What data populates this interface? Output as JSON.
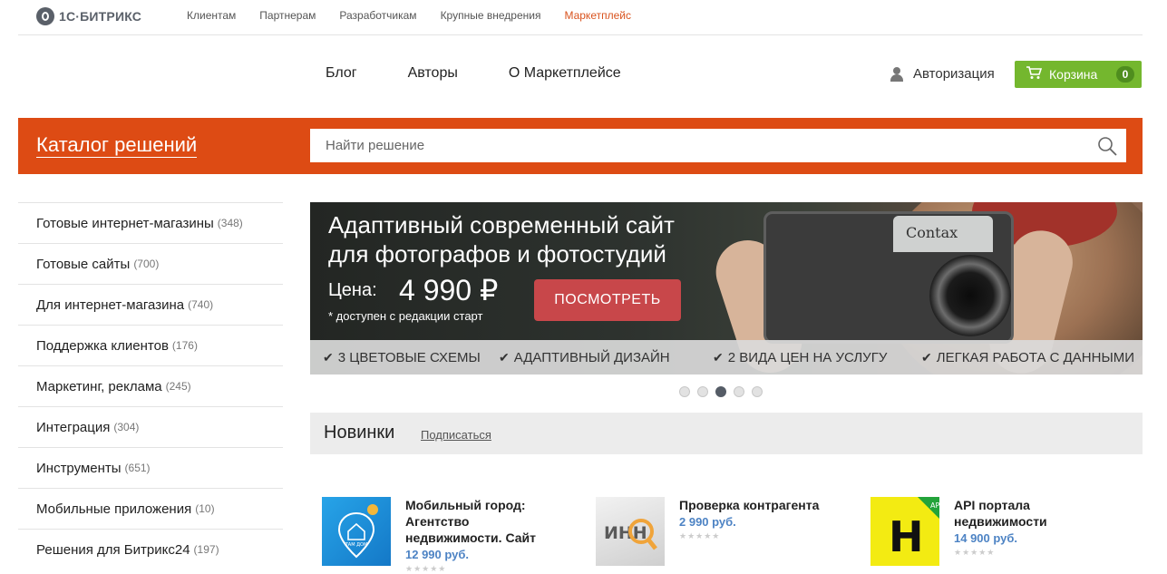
{
  "logo": {
    "text": "1С·БИТРИКС"
  },
  "top_nav": [
    "Клиентам",
    "Партнерам",
    "Разработчикам",
    "Крупные внедрения",
    "Маркетплейс"
  ],
  "main_nav": [
    "Блог",
    "Авторы",
    "О Маркетплейсе"
  ],
  "auth": {
    "label": "Авторизация"
  },
  "cart": {
    "label": "Корзина",
    "count": "0"
  },
  "catalog": {
    "title": "Каталог решений"
  },
  "search": {
    "placeholder": "Найти решение"
  },
  "sidebar": {
    "items": [
      {
        "label": "Готовые интернет-магазины",
        "count": "(348)"
      },
      {
        "label": "Готовые сайты",
        "count": "(700)"
      },
      {
        "label": "Для интернет-магазина",
        "count": "(740)"
      },
      {
        "label": "Поддержка клиентов",
        "count": "(176)"
      },
      {
        "label": "Маркетинг, реклама",
        "count": "(245)"
      },
      {
        "label": "Интеграция",
        "count": "(304)"
      },
      {
        "label": "Инструменты",
        "count": "(651)"
      },
      {
        "label": "Мобильные приложения",
        "count": "(10)"
      },
      {
        "label": "Решения для Битрикс24",
        "count": "(197)"
      }
    ]
  },
  "banner": {
    "title_line1": "Адаптивный современный сайт",
    "title_line2": "для фотографов и фотостудий",
    "price_label": "Цена:",
    "price_value": "4 990 ₽",
    "note": "* доступен  с редакции старт",
    "button": "ПОСМОТРЕТЬ",
    "features": [
      "3 ЦВЕТОВЫЕ СХЕМЫ",
      "АДАПТИВНЫЙ ДИЗАЙН",
      "2 ВИДА ЦЕН НА УСЛУГУ",
      "ЛЕГКАЯ РАБОТА С ДАННЫМИ"
    ],
    "camera_brand": "Contax"
  },
  "slider": {
    "total": 5,
    "active_index": 2
  },
  "news": {
    "title": "Новинки",
    "subscribe": "Подписаться"
  },
  "products": [
    {
      "name_line1": "Мобильный город:",
      "name_line2": "Агентство",
      "name_line3": "недвижимости. Сайт",
      "price": "12 990 руб.",
      "thumb_text": "ТАМ ДОМ"
    },
    {
      "name_line1": "Проверка контрагента",
      "price": "2 990 руб.",
      "thumb_text": "ИНН"
    },
    {
      "name_line1": "API портала",
      "name_line2": "недвижимости",
      "price": "14 900 руб.",
      "thumb_text": "H",
      "thumb_badge": "API"
    }
  ],
  "colors": {
    "accent": "#dd4b14",
    "cart_green": "#74b72e",
    "price_blue": "#4d83c4",
    "active_link": "#d9531e"
  }
}
